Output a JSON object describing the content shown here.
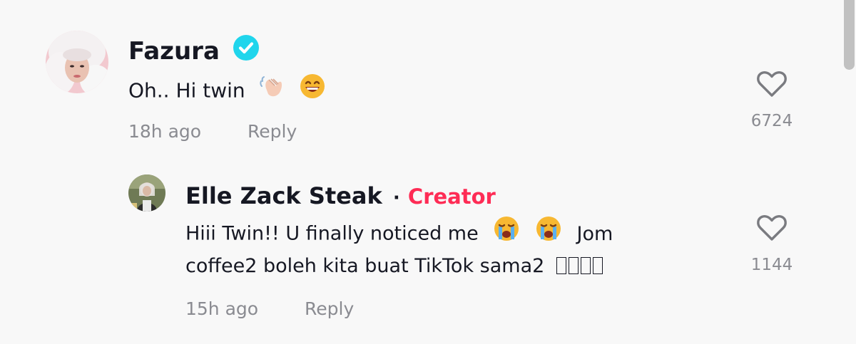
{
  "comments": [
    {
      "author": "Fazura",
      "verified": true,
      "text": "Oh.. Hi twin",
      "emojis": [
        "waving-hand-icon",
        "grinning-face-icon"
      ],
      "time": "18h ago",
      "reply_label": "Reply",
      "likes": "6724"
    },
    {
      "author": "Elle Zack Steak",
      "separator": "·",
      "badge": "Creator",
      "text_line1": "Hiii Twin!! U finally noticed me",
      "text_line1_after": "Jom",
      "text_line2": "coffee2 boleh kita buat TikTok sama2",
      "emojis": [
        "loudly-crying-face-icon",
        "loudly-crying-face-icon"
      ],
      "time": "15h ago",
      "reply_label": "Reply",
      "likes": "1144"
    }
  ],
  "colors": {
    "creator": "#fe2c55",
    "verified": "#20d5ec",
    "muted": "#8a8b91"
  }
}
